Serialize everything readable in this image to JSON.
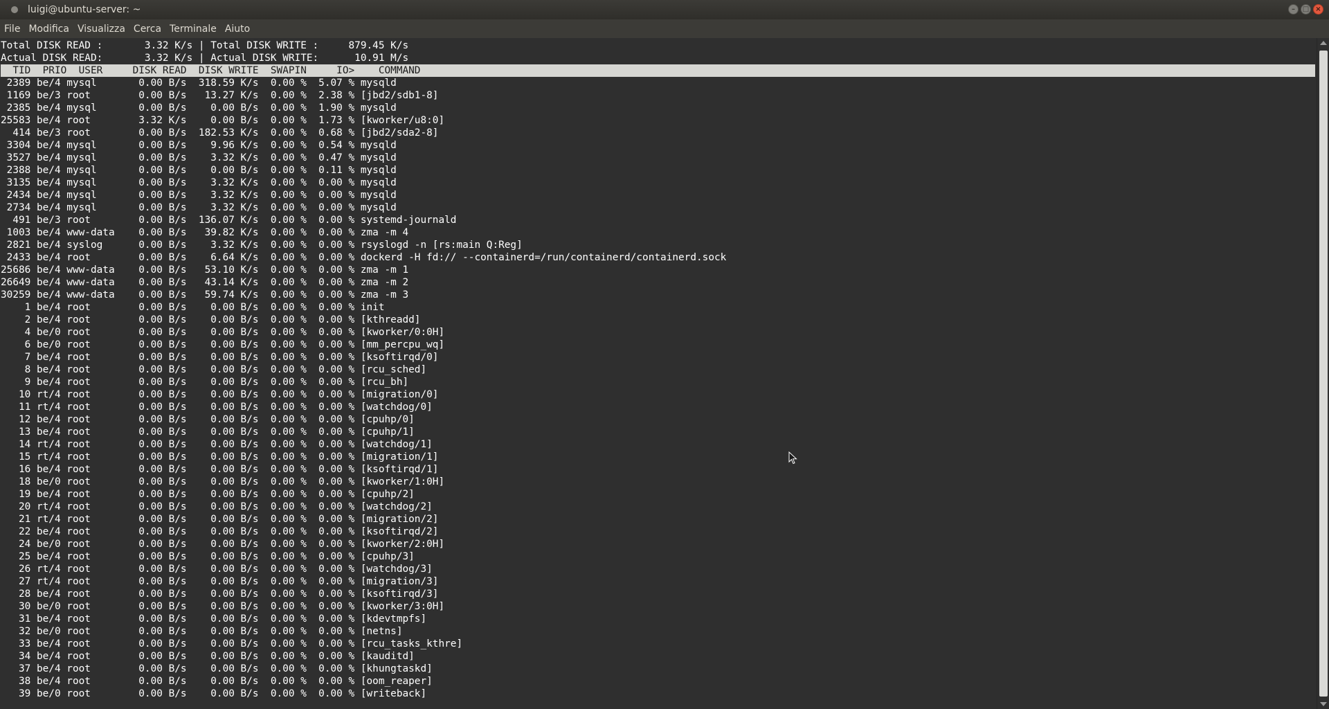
{
  "window": {
    "title": "luigi@ubuntu-server: ~",
    "buttons": {
      "minimize": "–",
      "maximize": "□",
      "close": "×"
    }
  },
  "menu": [
    "File",
    "Modifica",
    "Visualizza",
    "Cerca",
    "Terminale",
    "Aiuto"
  ],
  "terminal": {
    "summary": [
      "Total DISK READ :       3.32 K/s | Total DISK WRITE :     879.45 K/s",
      "Actual DISK READ:       3.32 K/s | Actual DISK WRITE:      10.91 M/s"
    ],
    "header": "  TID  PRIO  USER     DISK READ  DISK WRITE  SWAPIN     IO>    COMMAND",
    "rows": [
      " 2389 be/4 mysql       0.00 B/s  318.59 K/s  0.00 %  5.07 % mysqld",
      " 1169 be/3 root        0.00 B/s   13.27 K/s  0.00 %  2.38 % [jbd2/sdb1-8]",
      " 2385 be/4 mysql       0.00 B/s    0.00 B/s  0.00 %  1.90 % mysqld",
      "25583 be/4 root        3.32 K/s    0.00 B/s  0.00 %  1.73 % [kworker/u8:0]",
      "  414 be/3 root        0.00 B/s  182.53 K/s  0.00 %  0.68 % [jbd2/sda2-8]",
      " 3304 be/4 mysql       0.00 B/s    9.96 K/s  0.00 %  0.54 % mysqld",
      " 3527 be/4 mysql       0.00 B/s    3.32 K/s  0.00 %  0.47 % mysqld",
      " 2388 be/4 mysql       0.00 B/s    0.00 B/s  0.00 %  0.11 % mysqld",
      " 3135 be/4 mysql       0.00 B/s    3.32 K/s  0.00 %  0.00 % mysqld",
      " 2434 be/4 mysql       0.00 B/s    3.32 K/s  0.00 %  0.00 % mysqld",
      " 2734 be/4 mysql       0.00 B/s    3.32 K/s  0.00 %  0.00 % mysqld",
      "  491 be/3 root        0.00 B/s  136.07 K/s  0.00 %  0.00 % systemd-journald",
      " 1003 be/4 www-data    0.00 B/s   39.82 K/s  0.00 %  0.00 % zma -m 4",
      " 2821 be/4 syslog      0.00 B/s    3.32 K/s  0.00 %  0.00 % rsyslogd -n [rs:main Q:Reg]",
      " 2433 be/4 root        0.00 B/s    6.64 K/s  0.00 %  0.00 % dockerd -H fd:// --containerd=/run/containerd/containerd.sock",
      "25686 be/4 www-data    0.00 B/s   53.10 K/s  0.00 %  0.00 % zma -m 1",
      "26649 be/4 www-data    0.00 B/s   43.14 K/s  0.00 %  0.00 % zma -m 2",
      "30259 be/4 www-data    0.00 B/s   59.74 K/s  0.00 %  0.00 % zma -m 3",
      "    1 be/4 root        0.00 B/s    0.00 B/s  0.00 %  0.00 % init",
      "    2 be/4 root        0.00 B/s    0.00 B/s  0.00 %  0.00 % [kthreadd]",
      "    4 be/0 root        0.00 B/s    0.00 B/s  0.00 %  0.00 % [kworker/0:0H]",
      "    6 be/0 root        0.00 B/s    0.00 B/s  0.00 %  0.00 % [mm_percpu_wq]",
      "    7 be/4 root        0.00 B/s    0.00 B/s  0.00 %  0.00 % [ksoftirqd/0]",
      "    8 be/4 root        0.00 B/s    0.00 B/s  0.00 %  0.00 % [rcu_sched]",
      "    9 be/4 root        0.00 B/s    0.00 B/s  0.00 %  0.00 % [rcu_bh]",
      "   10 rt/4 root        0.00 B/s    0.00 B/s  0.00 %  0.00 % [migration/0]",
      "   11 rt/4 root        0.00 B/s    0.00 B/s  0.00 %  0.00 % [watchdog/0]",
      "   12 be/4 root        0.00 B/s    0.00 B/s  0.00 %  0.00 % [cpuhp/0]",
      "   13 be/4 root        0.00 B/s    0.00 B/s  0.00 %  0.00 % [cpuhp/1]",
      "   14 rt/4 root        0.00 B/s    0.00 B/s  0.00 %  0.00 % [watchdog/1]",
      "   15 rt/4 root        0.00 B/s    0.00 B/s  0.00 %  0.00 % [migration/1]",
      "   16 be/4 root        0.00 B/s    0.00 B/s  0.00 %  0.00 % [ksoftirqd/1]",
      "   18 be/0 root        0.00 B/s    0.00 B/s  0.00 %  0.00 % [kworker/1:0H]",
      "   19 be/4 root        0.00 B/s    0.00 B/s  0.00 %  0.00 % [cpuhp/2]",
      "   20 rt/4 root        0.00 B/s    0.00 B/s  0.00 %  0.00 % [watchdog/2]",
      "   21 rt/4 root        0.00 B/s    0.00 B/s  0.00 %  0.00 % [migration/2]",
      "   22 be/4 root        0.00 B/s    0.00 B/s  0.00 %  0.00 % [ksoftirqd/2]",
      "   24 be/0 root        0.00 B/s    0.00 B/s  0.00 %  0.00 % [kworker/2:0H]",
      "   25 be/4 root        0.00 B/s    0.00 B/s  0.00 %  0.00 % [cpuhp/3]",
      "   26 rt/4 root        0.00 B/s    0.00 B/s  0.00 %  0.00 % [watchdog/3]",
      "   27 rt/4 root        0.00 B/s    0.00 B/s  0.00 %  0.00 % [migration/3]",
      "   28 be/4 root        0.00 B/s    0.00 B/s  0.00 %  0.00 % [ksoftirqd/3]",
      "   30 be/0 root        0.00 B/s    0.00 B/s  0.00 %  0.00 % [kworker/3:0H]",
      "   31 be/4 root        0.00 B/s    0.00 B/s  0.00 %  0.00 % [kdevtmpfs]",
      "   32 be/0 root        0.00 B/s    0.00 B/s  0.00 %  0.00 % [netns]",
      "   33 be/4 root        0.00 B/s    0.00 B/s  0.00 %  0.00 % [rcu_tasks_kthre]",
      "   34 be/4 root        0.00 B/s    0.00 B/s  0.00 %  0.00 % [kauditd]",
      "   37 be/4 root        0.00 B/s    0.00 B/s  0.00 %  0.00 % [khungtaskd]",
      "   38 be/4 root        0.00 B/s    0.00 B/s  0.00 %  0.00 % [oom_reaper]",
      "   39 be/0 root        0.00 B/s    0.00 B/s  0.00 %  0.00 % [writeback]"
    ]
  }
}
